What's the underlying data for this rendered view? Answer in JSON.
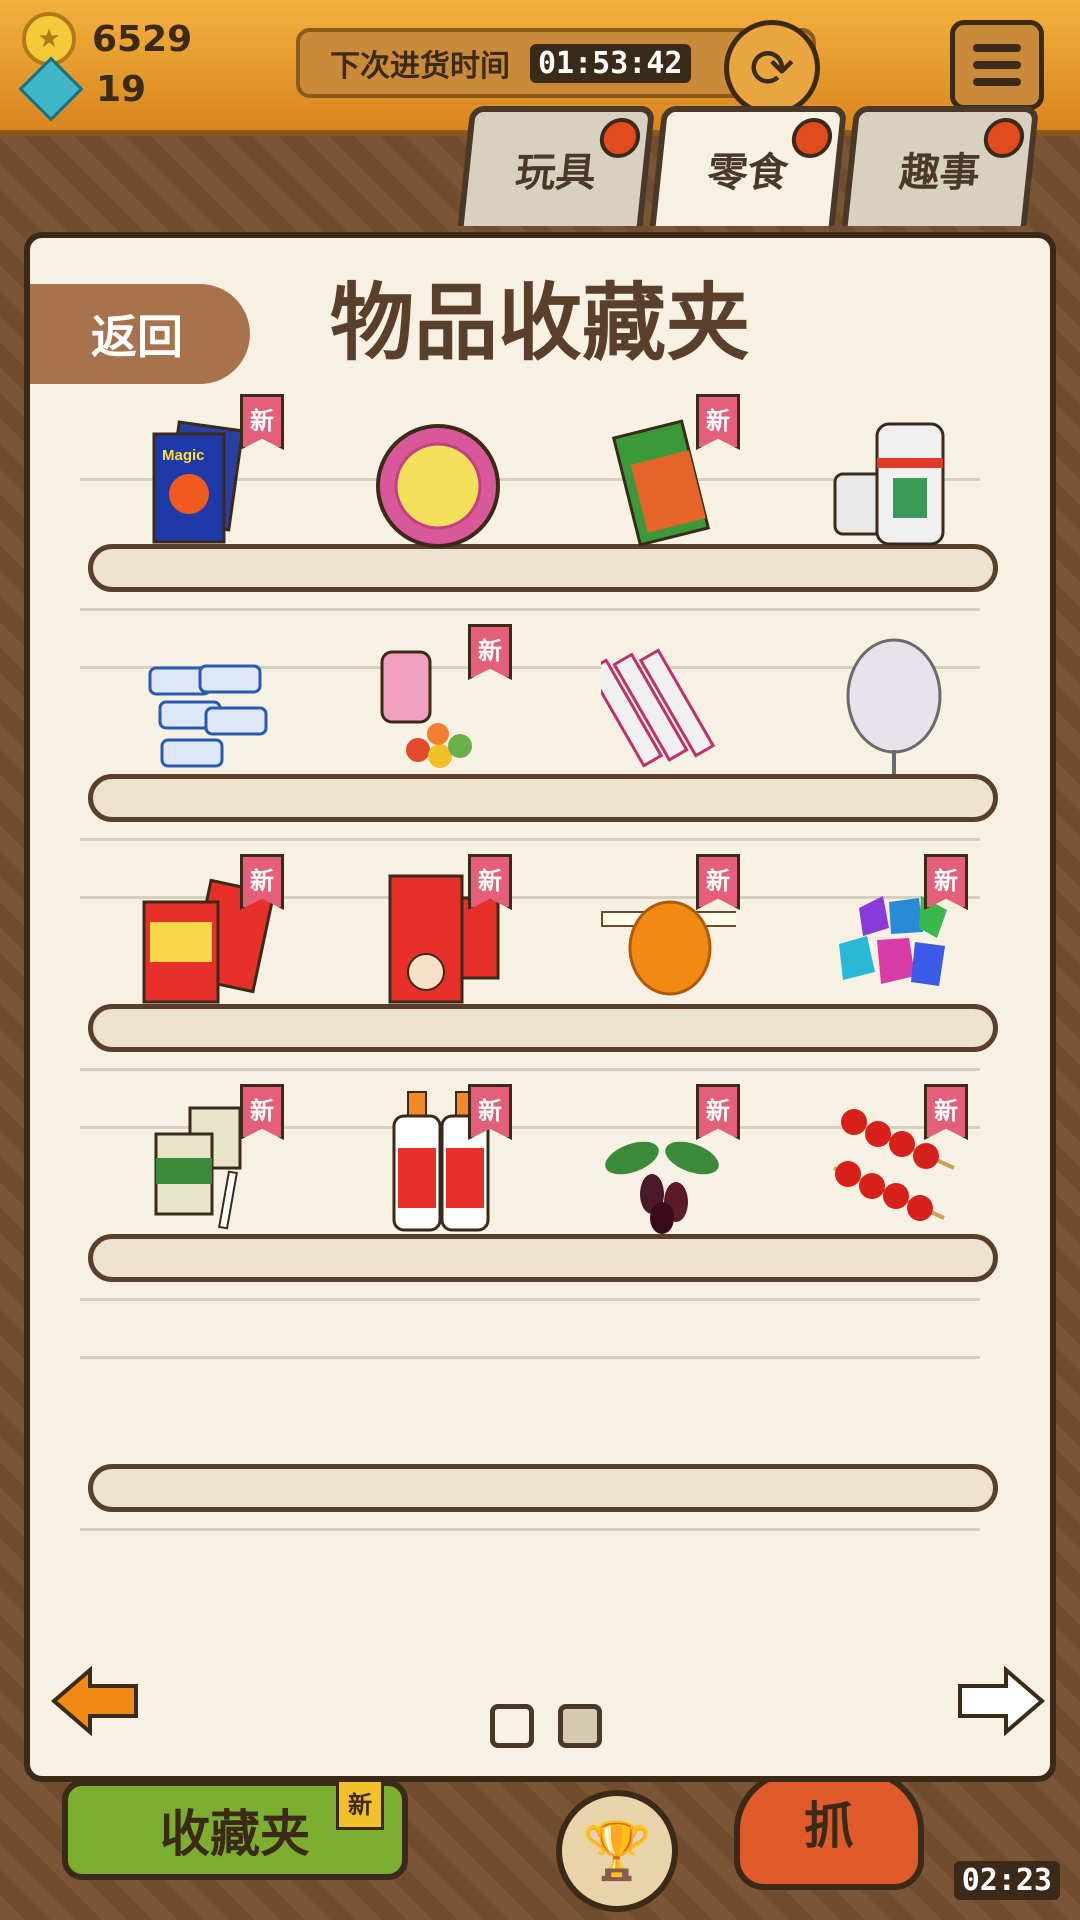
{
  "resources": {
    "coins": "6529",
    "gems": "19"
  },
  "restock": {
    "label": "下次进货时间",
    "time": "01:53:42"
  },
  "tabs": [
    {
      "label": "玩具",
      "active": false
    },
    {
      "label": "零食",
      "active": true
    },
    {
      "label": "趣事",
      "active": false
    }
  ],
  "panel": {
    "title": "物品收藏夹",
    "back_label": "返回",
    "new_badge": "新"
  },
  "items": [
    {
      "name": "magic-pop-candy",
      "new": true
    },
    {
      "name": "dadajuan-gum",
      "new": false
    },
    {
      "name": "spicy-strip-snack",
      "new": true
    },
    {
      "name": "jianlibao-soda",
      "new": false
    },
    {
      "name": "white-rabbit-candy",
      "new": false
    },
    {
      "name": "fruit-candy-jar",
      "new": true
    },
    {
      "name": "stick-candy",
      "new": false
    },
    {
      "name": "cotton-candy",
      "new": false
    },
    {
      "name": "mimi-snack",
      "new": true
    },
    {
      "name": "wangzai-milk-candy",
      "new": true
    },
    {
      "name": "sugar-painting",
      "new": true
    },
    {
      "name": "gem-candy",
      "new": true
    },
    {
      "name": "cigarette-candy",
      "new": true
    },
    {
      "name": "yogurt-drink",
      "new": true
    },
    {
      "name": "mulberry",
      "new": true
    },
    {
      "name": "candied-haws",
      "new": true
    }
  ],
  "pagination": {
    "pages": 2,
    "current": 2
  },
  "bottom": {
    "collect_label": "收藏夹",
    "new_badge": "新",
    "grab_label": "抓",
    "timer": "02:23"
  }
}
